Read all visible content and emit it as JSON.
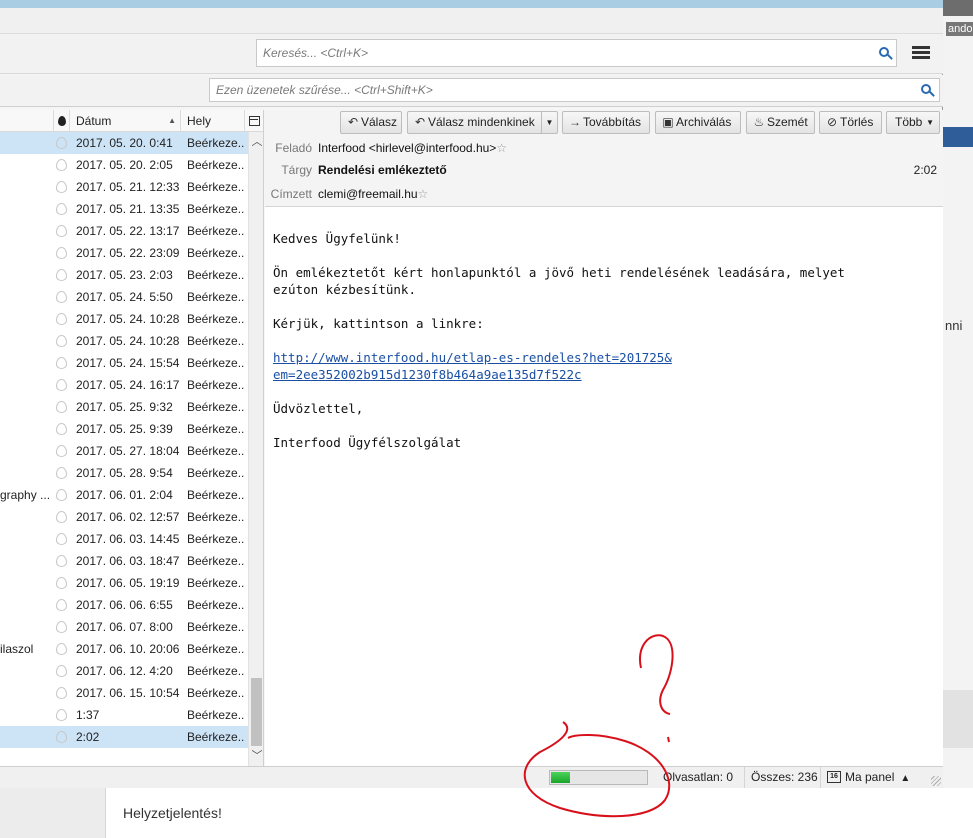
{
  "background": {
    "user_fragment": "andor",
    "side_text": "nni",
    "bottom_card_text": "Helyzetjelentés!"
  },
  "toolbar": {
    "search_placeholder": "Keresés... <Ctrl+K>"
  },
  "filterbar": {
    "filter_placeholder": "Ezen üzenetek szűrése... <Ctrl+Shift+K>"
  },
  "thread_pane": {
    "columns": {
      "date": "Dátum",
      "location": "Hely"
    },
    "rows": [
      {
        "subject": "",
        "date": "2017. 05. 20. 0:41",
        "location": "Beérkeze...",
        "selected": true
      },
      {
        "subject": "",
        "date": "2017. 05. 20. 2:05",
        "location": "Beérkeze...",
        "selected": false
      },
      {
        "subject": "",
        "date": "2017. 05. 21. 12:33",
        "location": "Beérkeze...",
        "selected": false
      },
      {
        "subject": "",
        "date": "2017. 05. 21. 13:35",
        "location": "Beérkeze...",
        "selected": false
      },
      {
        "subject": "",
        "date": "2017. 05. 22. 13:17",
        "location": "Beérkeze...",
        "selected": false
      },
      {
        "subject": "",
        "date": "2017. 05. 22. 23:09",
        "location": "Beérkeze...",
        "selected": false
      },
      {
        "subject": "",
        "date": "2017. 05. 23. 2:03",
        "location": "Beérkeze...",
        "selected": false
      },
      {
        "subject": "",
        "date": "2017. 05. 24. 5:50",
        "location": "Beérkeze...",
        "selected": false
      },
      {
        "subject": "",
        "date": "2017. 05. 24. 10:28",
        "location": "Beérkeze...",
        "selected": false
      },
      {
        "subject": "",
        "date": "2017. 05. 24. 10:28",
        "location": "Beérkeze...",
        "selected": false
      },
      {
        "subject": "",
        "date": "2017. 05. 24. 15:54",
        "location": "Beérkeze...",
        "selected": false
      },
      {
        "subject": "",
        "date": "2017. 05. 24. 16:17",
        "location": "Beérkeze...",
        "selected": false
      },
      {
        "subject": "",
        "date": "2017. 05. 25. 9:32",
        "location": "Beérkeze...",
        "selected": false
      },
      {
        "subject": "",
        "date": "2017. 05. 25. 9:39",
        "location": "Beérkeze...",
        "selected": false
      },
      {
        "subject": "",
        "date": "2017. 05. 27. 18:04",
        "location": "Beérkeze...",
        "selected": false
      },
      {
        "subject": "",
        "date": "2017. 05. 28. 9:54",
        "location": "Beérkeze...",
        "selected": false
      },
      {
        "subject": "graphy ...",
        "date": "2017. 06. 01. 2:04",
        "location": "Beérkeze...",
        "selected": false
      },
      {
        "subject": "",
        "date": "2017. 06. 02. 12:57",
        "location": "Beérkeze...",
        "selected": false
      },
      {
        "subject": "",
        "date": "2017. 06. 03. 14:45",
        "location": "Beérkeze...",
        "selected": false
      },
      {
        "subject": "",
        "date": "2017. 06. 03. 18:47",
        "location": "Beérkeze...",
        "selected": false
      },
      {
        "subject": "",
        "date": "2017. 06. 05. 19:19",
        "location": "Beérkeze...",
        "selected": false
      },
      {
        "subject": "",
        "date": "2017. 06. 06. 6:55",
        "location": "Beérkeze...",
        "selected": false
      },
      {
        "subject": "",
        "date": "2017. 06. 07. 8:00",
        "location": "Beérkeze...",
        "selected": false
      },
      {
        "subject": "ilaszol",
        "date": "2017. 06. 10. 20:06",
        "location": "Beérkeze...",
        "selected": false
      },
      {
        "subject": "",
        "date": "2017. 06. 12. 4:20",
        "location": "Beérkeze...",
        "selected": false
      },
      {
        "subject": "",
        "date": "2017. 06. 15. 10:54",
        "location": "Beérkeze...",
        "selected": false
      },
      {
        "subject": "",
        "date": "1:37",
        "location": "Beérkeze...",
        "selected": false
      },
      {
        "subject": "",
        "date": "2:02",
        "location": "Beérkeze...",
        "selected": true
      }
    ]
  },
  "message": {
    "buttons": {
      "reply": "Válasz",
      "reply_all": "Válasz mindenkinek",
      "forward": "Továbbítás",
      "archive": "Archiválás",
      "junk": "Szemét",
      "delete": "Törlés",
      "more": "Több"
    },
    "from_label": "Feladó",
    "from": "Interfood <hirlevel@interfood.hu>",
    "subject_label": "Tárgy",
    "subject": "Rendelési emlékeztető",
    "time": "2:02",
    "to_label": "Címzett",
    "to": "clemi@freemail.hu",
    "body": {
      "greeting": "Kedves Ügyfelünk!",
      "para1": "Ön emlékeztetőt kért honlapunktól a jövő heti rendelésének leadására, melyet\nezúton kézbesítünk.",
      "para2": "Kérjük, kattintson a linkre:",
      "link": "http://www.interfood.hu/etlap-es-rendeles?het=201725&\nem=2ee352002b915d1230f8b464a9ae135d7f522c",
      "closing": "Üdvözlettel,",
      "signature": "Interfood Ügyfélszolgálat"
    }
  },
  "statusbar": {
    "progress_fraction": 0.2,
    "unread": "Olvasatlan: 0",
    "total": "Összes: 236",
    "today_pane": "Ma panel",
    "calendar_day": "16"
  },
  "colors": {
    "selection": "#cde4f7",
    "link": "#1a4fa3",
    "annotation": "#d8101a",
    "progress": "#19a52a"
  }
}
